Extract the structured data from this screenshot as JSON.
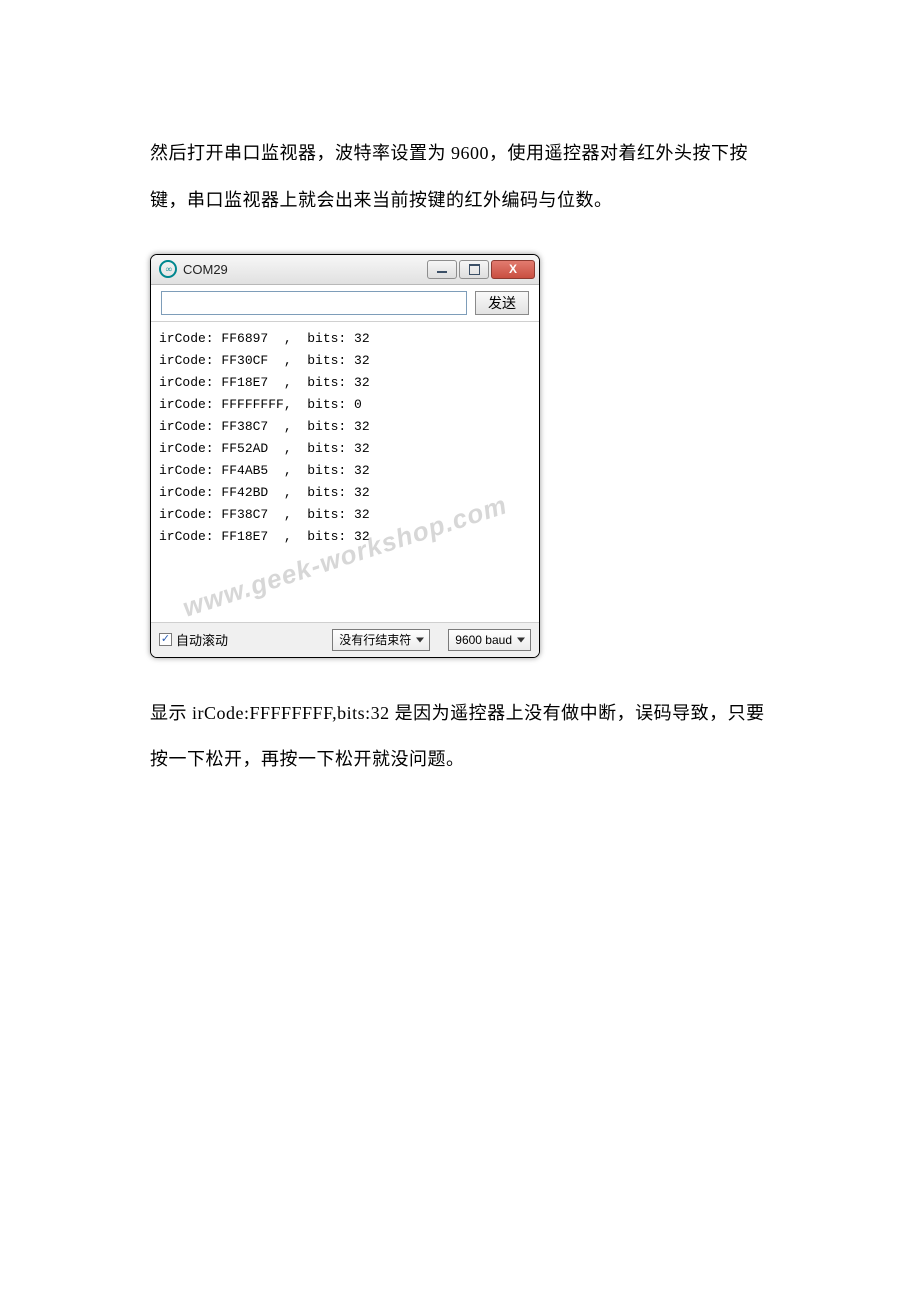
{
  "paragraph1": "然后打开串口监视器，波特率设置为 9600，使用遥控器对着红外头按下按键，串口监视器上就会出来当前按键的红外编码与位数。",
  "paragraph2": "显示 irCode:FFFFFFFF,bits:32 是因为遥控器上没有做中断，误码导致，只要按一下松开，再按一下松开就没问题。",
  "serial": {
    "title": "COM29",
    "icon_name": "arduino-icon",
    "send_placeholder": "",
    "send_button": "发送",
    "close_glyph": "X",
    "watermark": "www.geek-workshop.com",
    "output_lines": [
      {
        "code": "FF6897",
        "bits": "32"
      },
      {
        "code": "FF30CF",
        "bits": "32"
      },
      {
        "code": "FF18E7",
        "bits": "32"
      },
      {
        "code": "FFFFFFFF",
        "bits": "0"
      },
      {
        "code": "FF38C7",
        "bits": "32"
      },
      {
        "code": "FF52AD",
        "bits": "32"
      },
      {
        "code": "FF4AB5",
        "bits": "32"
      },
      {
        "code": "FF42BD",
        "bits": "32"
      },
      {
        "code": "FF38C7",
        "bits": "32"
      },
      {
        "code": "FF18E7",
        "bits": "32"
      }
    ],
    "footer": {
      "autoscroll_label": "自动滚动",
      "autoscroll_checked": true,
      "line_ending": "没有行结束符",
      "baud": "9600 baud"
    }
  }
}
